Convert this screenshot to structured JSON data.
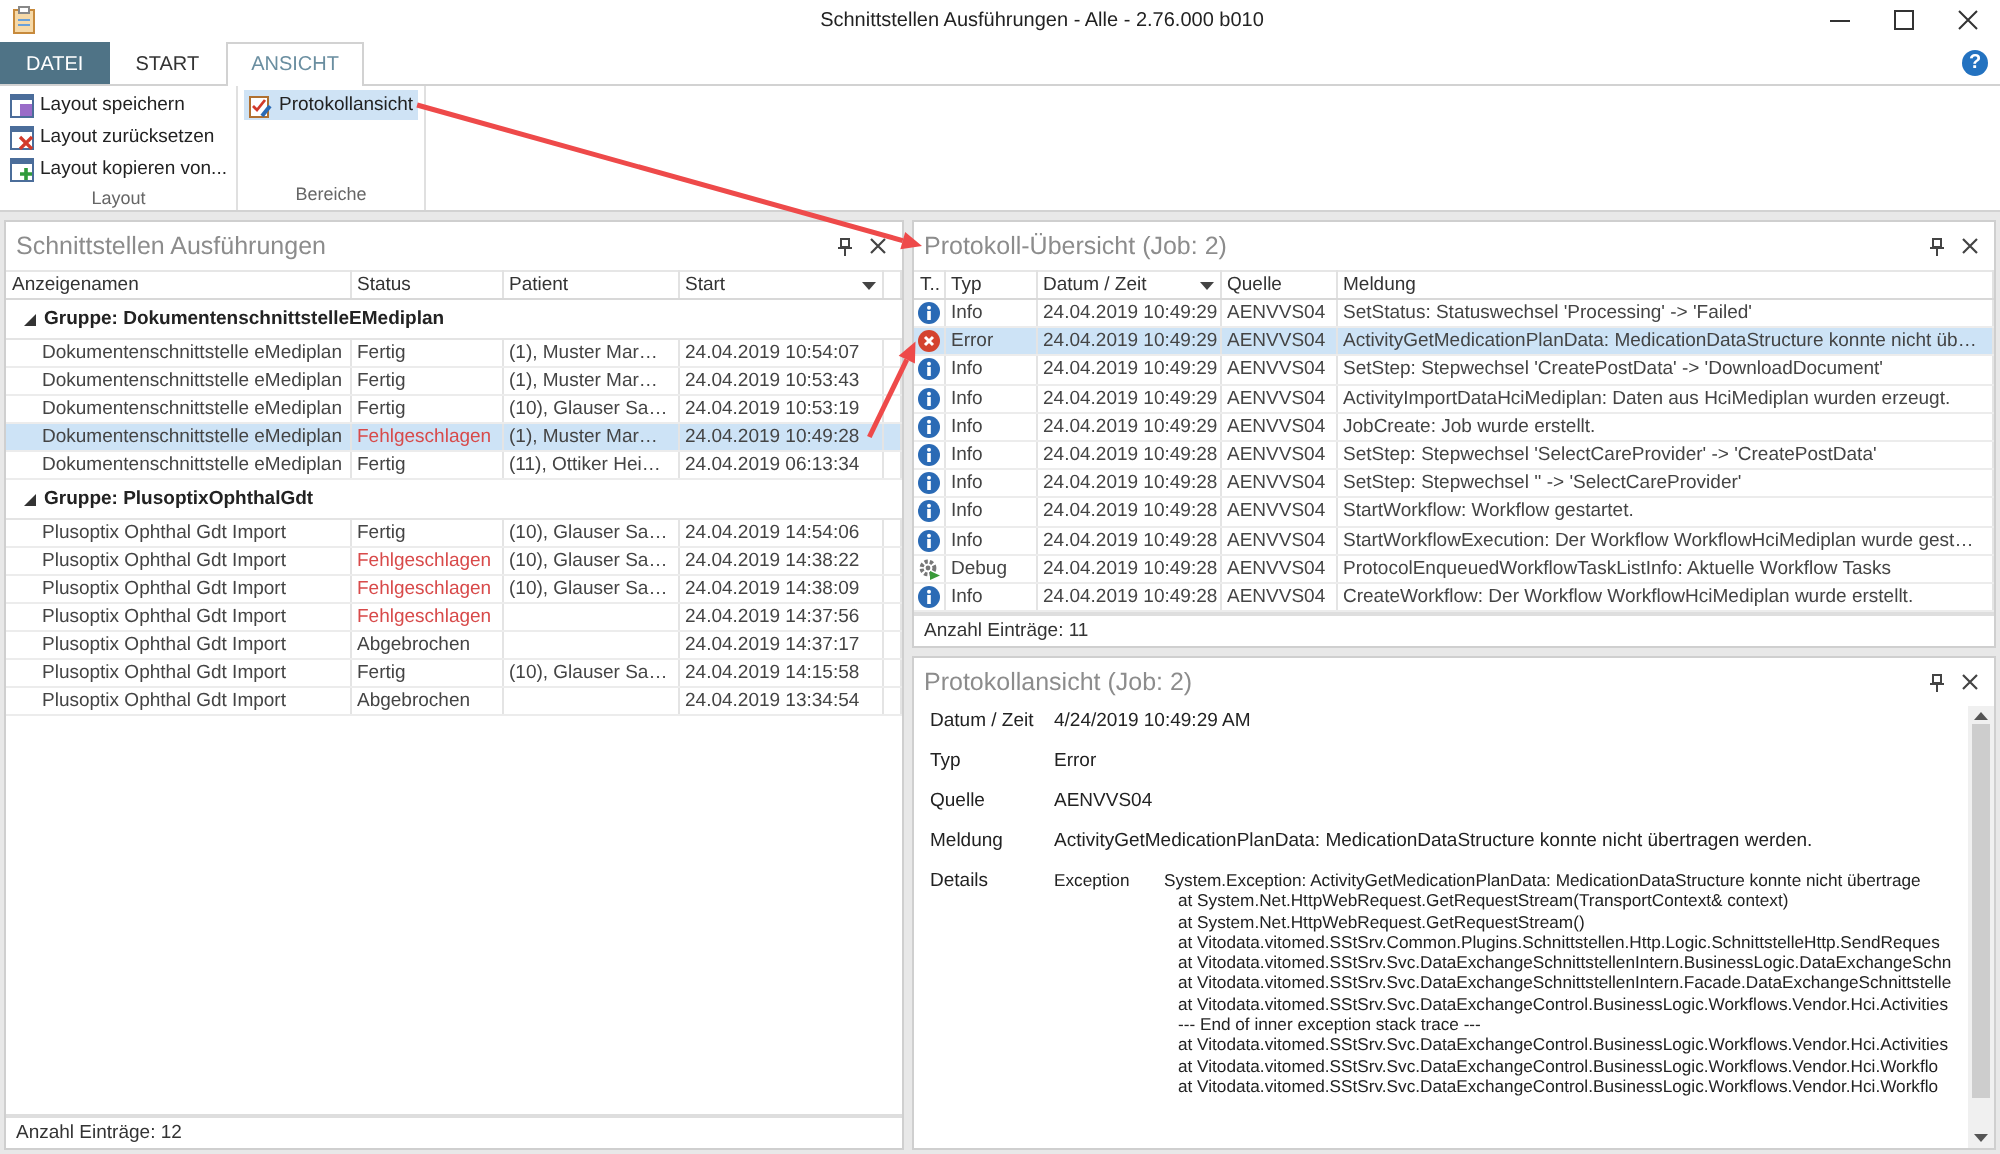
{
  "window": {
    "title": "Schnittstellen Ausführungen - Alle - 2.76.000 b010",
    "help": "?"
  },
  "ribbon": {
    "tabs": [
      {
        "label": "DATEI",
        "kind": "file",
        "selected": false
      },
      {
        "label": "START",
        "kind": "tab",
        "selected": false
      },
      {
        "label": "ANSICHT",
        "kind": "tab",
        "selected": true
      }
    ],
    "groups": [
      {
        "label": "Layout",
        "items": [
          {
            "label": "Layout speichern",
            "kind": "save",
            "selected": false
          },
          {
            "label": "Layout zurücksetzen",
            "kind": "reset",
            "selected": false
          },
          {
            "label": "Layout kopieren von...",
            "kind": "copy",
            "selected": false
          }
        ]
      },
      {
        "label": "Bereiche",
        "items": [
          {
            "label": "Protokollansicht",
            "kind": "log",
            "selected": true
          }
        ]
      }
    ]
  },
  "executions": {
    "title": "Schnittstellen Ausführungen",
    "columns": [
      {
        "label": "Anzeigenamen",
        "sorted": false
      },
      {
        "label": "Status",
        "sorted": false
      },
      {
        "label": "Patient",
        "sorted": false
      },
      {
        "label": "Start",
        "sorted": true
      }
    ],
    "groups": [
      {
        "label": "Gruppe: DokumentenschnittstelleEMediplan",
        "expanded": true,
        "rows": [
          {
            "name": "Dokumentenschnittstelle eMediplan",
            "status": "Fertig",
            "failed": false,
            "patient": "(1), Muster Mar…",
            "start": "24.04.2019 10:54:07",
            "selected": false
          },
          {
            "name": "Dokumentenschnittstelle eMediplan",
            "status": "Fertig",
            "failed": false,
            "patient": "(1), Muster Mar…",
            "start": "24.04.2019 10:53:43",
            "selected": false
          },
          {
            "name": "Dokumentenschnittstelle eMediplan",
            "status": "Fertig",
            "failed": false,
            "patient": "(10), Glauser Sa…",
            "start": "24.04.2019 10:53:19",
            "selected": false
          },
          {
            "name": "Dokumentenschnittstelle eMediplan",
            "status": "Fehlgeschlagen",
            "failed": true,
            "patient": "(1), Muster Mar…",
            "start": "24.04.2019 10:49:28",
            "selected": true
          },
          {
            "name": "Dokumentenschnittstelle eMediplan",
            "status": "Fertig",
            "failed": false,
            "patient": "(11), Ottiker Hei…",
            "start": "24.04.2019 06:13:34",
            "selected": false
          }
        ]
      },
      {
        "label": "Gruppe: PlusoptixOphthalGdt",
        "expanded": true,
        "rows": [
          {
            "name": "Plusoptix Ophthal Gdt Import",
            "status": "Fertig",
            "failed": false,
            "patient": "(10), Glauser Sa…",
            "start": "24.04.2019 14:54:06",
            "selected": false
          },
          {
            "name": "Plusoptix Ophthal Gdt Import",
            "status": "Fehlgeschlagen",
            "failed": true,
            "patient": "(10), Glauser Sa…",
            "start": "24.04.2019 14:38:22",
            "selected": false
          },
          {
            "name": "Plusoptix Ophthal Gdt Import",
            "status": "Fehlgeschlagen",
            "failed": true,
            "patient": "(10), Glauser Sa…",
            "start": "24.04.2019 14:38:09",
            "selected": false
          },
          {
            "name": "Plusoptix Ophthal Gdt Import",
            "status": "Fehlgeschlagen",
            "failed": true,
            "start": "24.04.2019 14:37:56",
            "selected": false
          },
          {
            "name": "Plusoptix Ophthal Gdt Import",
            "status": "Abgebrochen",
            "failed": false,
            "start": "24.04.2019 14:37:17",
            "selected": false
          },
          {
            "name": "Plusoptix Ophthal Gdt Import",
            "status": "Fertig",
            "failed": false,
            "patient": "(10), Glauser Sa…",
            "start": "24.04.2019 14:15:58",
            "selected": false
          },
          {
            "name": "Plusoptix Ophthal Gdt Import",
            "status": "Abgebrochen",
            "failed": false,
            "start": "24.04.2019 13:34:54",
            "selected": false
          }
        ]
      }
    ],
    "footer": "Anzahl Einträge: 12"
  },
  "log": {
    "title": "Protokoll-Übersicht (Job: 2)",
    "columns": [
      {
        "label": "T..",
        "sorted": false
      },
      {
        "label": "Typ",
        "sorted": false
      },
      {
        "label": "Datum / Zeit",
        "sorted": true
      },
      {
        "label": "Quelle",
        "sorted": false
      },
      {
        "label": "Meldung",
        "sorted": false
      }
    ],
    "rows": [
      {
        "kind": "info",
        "type": "Info",
        "date": "24.04.2019 10:49:29",
        "source": "AENVVS04",
        "message": "SetStatus: Statuswechsel 'Processing' -> 'Failed'",
        "selected": false
      },
      {
        "kind": "error",
        "type": "Error",
        "date": "24.04.2019 10:49:29",
        "source": "AENVVS04",
        "message": "ActivityGetMedicationPlanData: MedicationDataStructure konnte nicht üb…",
        "selected": true
      },
      {
        "kind": "info",
        "type": "Info",
        "date": "24.04.2019 10:49:29",
        "source": "AENVVS04",
        "message": "SetStep: Stepwechsel 'CreatePostData' -> 'DownloadDocument'",
        "selected": false
      },
      {
        "kind": "info",
        "type": "Info",
        "date": "24.04.2019 10:49:29",
        "source": "AENVVS04",
        "message": "ActivityImportDataHciMediplan: Daten aus HciMediplan wurden erzeugt.",
        "selected": false
      },
      {
        "kind": "info",
        "type": "Info",
        "date": "24.04.2019 10:49:29",
        "source": "AENVVS04",
        "message": "JobCreate: Job wurde erstellt.",
        "selected": false
      },
      {
        "kind": "info",
        "type": "Info",
        "date": "24.04.2019 10:49:28",
        "source": "AENVVS04",
        "message": "SetStep: Stepwechsel 'SelectCareProvider' -> 'CreatePostData'",
        "selected": false
      },
      {
        "kind": "info",
        "type": "Info",
        "date": "24.04.2019 10:49:28",
        "source": "AENVVS04",
        "message": "SetStep: Stepwechsel '' -> 'SelectCareProvider'",
        "selected": false
      },
      {
        "kind": "info",
        "type": "Info",
        "date": "24.04.2019 10:49:28",
        "source": "AENVVS04",
        "message": "StartWorkflow: Workflow gestartet.",
        "selected": false
      },
      {
        "kind": "info",
        "type": "Info",
        "date": "24.04.2019 10:49:28",
        "source": "AENVVS04",
        "message": "StartWorkflowExecution: Der Workflow WorkflowHciMediplan wurde gest…",
        "selected": false
      },
      {
        "kind": "debug",
        "type": "Debug",
        "date": "24.04.2019 10:49:28",
        "source": "AENVVS04",
        "message": "ProtocolEnqueuedWorkflowTaskListInfo: Aktuelle Workflow Tasks",
        "selected": false
      },
      {
        "kind": "info",
        "type": "Info",
        "date": "24.04.2019 10:49:28",
        "source": "AENVVS04",
        "message": "CreateWorkflow: Der Workflow WorkflowHciMediplan wurde erstellt.",
        "selected": false
      }
    ],
    "footer": "Anzahl Einträge: 11"
  },
  "detail": {
    "title": "Protokollansicht (Job: 2)",
    "fields": [
      {
        "label": "Datum / Zeit",
        "value": "4/24/2019 10:49:29 AM"
      },
      {
        "label": "Typ",
        "value": "Error"
      },
      {
        "label": "Quelle",
        "value": "AENVVS04"
      },
      {
        "label": "Meldung",
        "value": "ActivityGetMedicationPlanData: MedicationDataStructure konnte nicht übertragen werden."
      }
    ],
    "details": {
      "label": "Details",
      "exception_label": "Exception",
      "exception": "System.Exception: ActivityGetMedicationPlanData: MedicationDataStructure konnte nicht übertrage",
      "trace": [
        "at System.Net.HttpWebRequest.GetRequestStream(TransportContext& context)",
        "at System.Net.HttpWebRequest.GetRequestStream()",
        "at Vitodata.vitomed.SStSrv.Common.Plugins.Schnittstellen.Http.Logic.SchnittstelleHttp.SendReques",
        "at Vitodata.vitomed.SStSrv.Svc.DataExchangeSchnittstellenIntern.BusinessLogic.DataExchangeSchn",
        "at Vitodata.vitomed.SStSrv.Svc.DataExchangeSchnittstellenIntern.Facade.DataExchangeSchnittstelle",
        "at Vitodata.vitomed.SStSrv.Svc.DataExchangeControl.BusinessLogic.Workflows.Vendor.Hci.Activities",
        "--- End of inner exception stack trace ---",
        "at Vitodata.vitomed.SStSrv.Svc.DataExchangeControl.BusinessLogic.Workflows.Vendor.Hci.Activities",
        "at Vitodata.vitomed.SStSrv.Svc.DataExchangeControl.BusinessLogic.Workflows.Vendor.Hci.Workflo",
        "at Vitodata.vitomed.SStSrv.Svc.DataExchangeControl.BusinessLogic.Workflows.Vendor.Hci.Workflo"
      ]
    }
  }
}
